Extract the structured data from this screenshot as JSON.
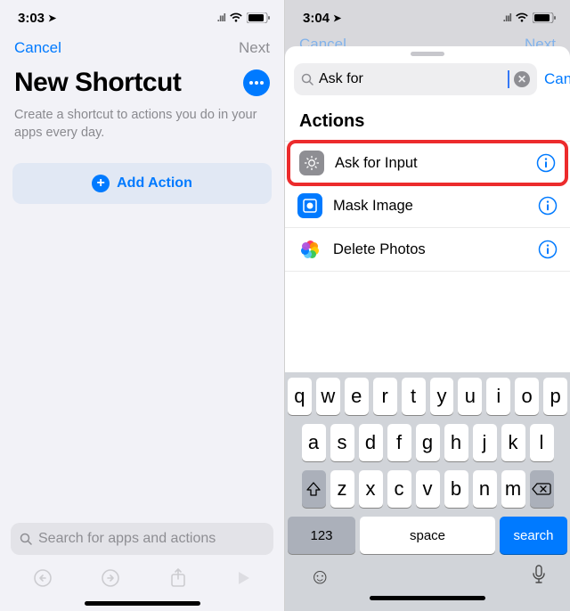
{
  "left": {
    "status_time": "3:03",
    "nav": {
      "cancel": "Cancel",
      "next": "Next"
    },
    "title": "New Shortcut",
    "subtitle": "Create a shortcut to actions you do in your apps every day.",
    "add_action": "Add Action",
    "search_placeholder": "Search for apps and actions"
  },
  "right": {
    "status_time": "3:04",
    "faded": {
      "cancel": "Cancel",
      "next": "Next"
    },
    "search_value": "Ask for",
    "cancel": "Cancel",
    "section": "Actions",
    "results": [
      {
        "label": "Ask for Input"
      },
      {
        "label": "Mask Image"
      },
      {
        "label": "Delete Photos"
      }
    ],
    "keyboard": {
      "row1": [
        "q",
        "w",
        "e",
        "r",
        "t",
        "y",
        "u",
        "i",
        "o",
        "p"
      ],
      "row2": [
        "a",
        "s",
        "d",
        "f",
        "g",
        "h",
        "j",
        "k",
        "l"
      ],
      "row3": [
        "z",
        "x",
        "c",
        "v",
        "b",
        "n",
        "m"
      ],
      "k123": "123",
      "space": "space",
      "search": "search"
    }
  }
}
